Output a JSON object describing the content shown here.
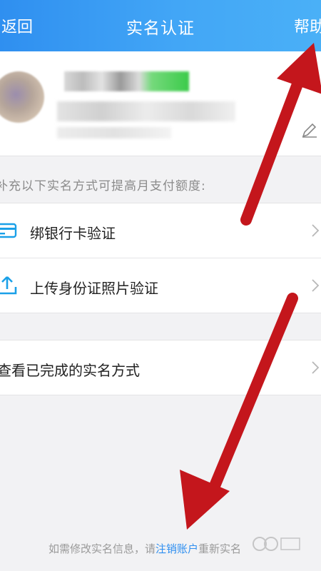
{
  "topbar": {
    "back": "返回",
    "title": "实名认证",
    "help": "帮助"
  },
  "profile": {
    "edit_icon": "pencil-icon"
  },
  "section_tip": "补充以下实名方式可提高月支付额度:",
  "methods": [
    {
      "label": "绑银行卡验证",
      "icon": "bank-card-icon"
    },
    {
      "label": "上传身份证照片验证",
      "icon": "upload-icon"
    }
  ],
  "completed": {
    "label": "查看已完成的实名方式"
  },
  "footer": {
    "prefix": "如需修改实名信息，请",
    "link": "注销账户",
    "suffix": "重新实名"
  },
  "colors": {
    "accent": "#2f8ff0",
    "arrow": "#c4161c"
  }
}
